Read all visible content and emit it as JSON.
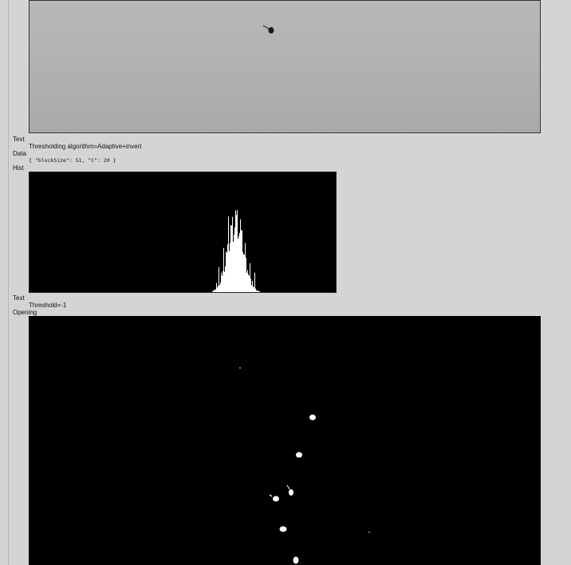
{
  "sections": {
    "text1_label": "Text",
    "text1_value": "Thresholding algorithm=Adaptive+invert",
    "data_label": "Data",
    "data_value": "{ \"blockSize\": 51, \"C\": 20 }",
    "hist_label": "Hist",
    "text2_label": "Text",
    "text2_value": "Threshold=-1",
    "opening_label": "Opening"
  },
  "colors": {
    "background": "#d4d4d4",
    "image_gray": "#b0b0b0",
    "histogram_bg": "#000000",
    "histogram_fg": "#ffffff"
  }
}
